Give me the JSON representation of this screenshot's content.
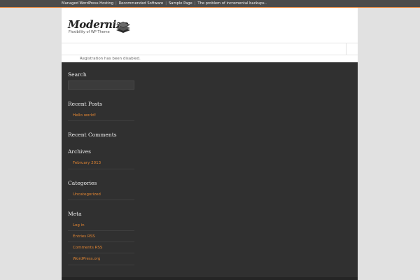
{
  "top_nav": {
    "items": [
      "Managed WordPress Hosting",
      "Recommended Software",
      "Sample Page",
      "The problem of incremental backups.."
    ],
    "separator": "|"
  },
  "colors": {
    "top_bar": "#4b4b4b",
    "accent": "#e07a2a",
    "content_background": "#303030",
    "page_background": "#e1e1e1",
    "link": "#e48632"
  },
  "header": {
    "logo_title": "Modernize",
    "logo_tagline": "Flexibility of WP Theme",
    "logo_icon": "stacked-layers-icon"
  },
  "notice": "Registration has been disabled.",
  "sidebar": {
    "search": {
      "title": "Search",
      "placeholder": ""
    },
    "recent_posts": {
      "title": "Recent Posts",
      "items": [
        "Hello world!"
      ]
    },
    "recent_comments": {
      "title": "Recent Comments"
    },
    "archives": {
      "title": "Archives",
      "items": [
        "February 2013"
      ]
    },
    "categories": {
      "title": "Categories",
      "items": [
        "Uncategorized"
      ]
    },
    "meta": {
      "title": "Meta",
      "items": [
        "Log in",
        "Entries RSS",
        "Comments RSS",
        "WordPress.org"
      ]
    }
  }
}
